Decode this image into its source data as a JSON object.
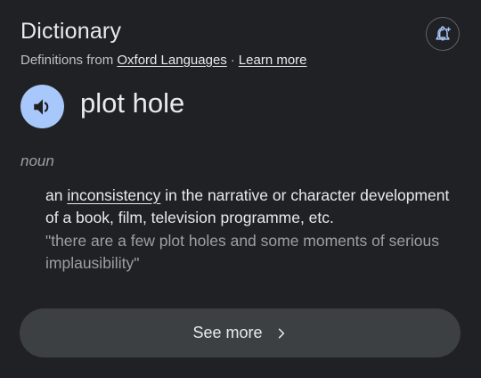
{
  "header": {
    "title": "Dictionary",
    "source_prefix": "Definitions from",
    "source_link": "Oxford Languages",
    "separator": "·",
    "learn_more": "Learn more",
    "alert_icon": "notification-add-icon"
  },
  "entry": {
    "pronounce_icon": "speaker-icon",
    "word": "plot hole",
    "part_of_speech": "noun",
    "definition_prefix": "an",
    "definition_link": "inconsistency",
    "definition_rest": "in the narrative or character development of a book, film, television programme, etc.",
    "example": "\"there are a few plot holes and some moments of serious implausibility\""
  },
  "footer": {
    "see_more_label": "See more",
    "chevron_icon": "chevron-right-icon"
  },
  "colors": {
    "background": "#202124",
    "text_primary": "#e8eaed",
    "text_secondary": "#9aa0a6",
    "speaker_accent": "#a8c7fa",
    "button_bg": "#3c4043"
  }
}
